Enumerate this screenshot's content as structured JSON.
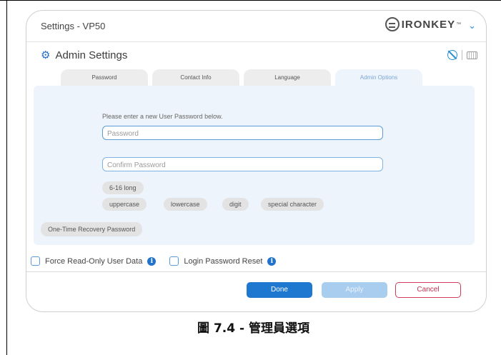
{
  "window": {
    "title": "Settings - VP50",
    "brand": "IRONKEY",
    "brand_tm": "™",
    "brand_chevron": "⌄"
  },
  "section": {
    "title": "Admin Settings",
    "icons": [
      "gear-icon",
      "eye-off-icon",
      "keyboard-icon"
    ]
  },
  "tabs": [
    {
      "label": "Password",
      "active": false
    },
    {
      "label": "Contact Info",
      "active": false
    },
    {
      "label": "Language",
      "active": false
    },
    {
      "label": "Admin Options",
      "active": true
    }
  ],
  "form": {
    "prompt": "Please enter a new User Password below.",
    "password_placeholder": "Password",
    "password_value": "",
    "confirm_placeholder": "Confirm Password",
    "confirm_value": "",
    "rules": [
      "6-16 long",
      "uppercase",
      "lowercase",
      "digit",
      "special character"
    ],
    "recovery_label": "One-Time Recovery Password"
  },
  "options": {
    "force_read_only": {
      "label": "Force Read-Only User Data",
      "checked": false
    },
    "login_password_reset": {
      "label": "Login Password Reset",
      "checked": false
    }
  },
  "buttons": {
    "done": "Done",
    "apply": "Apply",
    "cancel": "Cancel"
  },
  "colors": {
    "accent": "#1f78cf",
    "panel": "#eef4fb",
    "cancel": "#d23b5a"
  },
  "caption": "圖 7.4 - 管理員選項"
}
